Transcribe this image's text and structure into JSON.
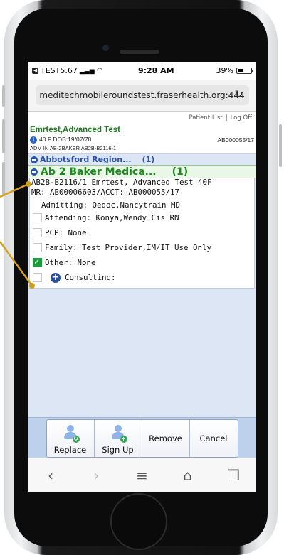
{
  "status_bar": {
    "carrier": "TEST5.67",
    "time": "9:28 AM",
    "battery_text": "39%",
    "battery_level": 0.39
  },
  "browser": {
    "url": "meditechmobileroundstest.fraserhealth.org:444"
  },
  "top_links": {
    "patient_list": "Patient List",
    "separator": "|",
    "log_off": "Log Off"
  },
  "patient": {
    "name": "Emrtest,Advanced Test",
    "demographics": "40 F DOB:19/07/78",
    "account": "AB000055/17",
    "admission": "ADM IN AB-2BAKER AB2B-B2116-1"
  },
  "region": {
    "label": "Abbotsford Region...",
    "count": "(1)"
  },
  "unit": {
    "label": "Ab 2 Baker Medica...",
    "count": "(1)"
  },
  "card": {
    "line1": "AB2B-B2116/1 Emrtest, Advanced Test 40F",
    "line2": "MR: AB00006603/ACCT: AB000055/17",
    "admitting": "Admitting: Oedoc,Nancytrain MD",
    "providers": [
      {
        "label": "Attending: Konya,Wendy Cis RN",
        "checked": false
      },
      {
        "label": "PCP: None",
        "checked": false
      },
      {
        "label": "Family: Test Provider,IM/IT Use Only",
        "checked": false
      },
      {
        "label": "Other: None",
        "checked": true
      }
    ],
    "consulting": "Consulting:"
  },
  "actions": {
    "replace": "Replace",
    "sign_up": "Sign Up",
    "remove": "Remove",
    "cancel": "Cancel"
  },
  "colors": {
    "patient_name": "#1f7a1f",
    "region": "#2a52a8",
    "unit": "#1f8a1f",
    "annotation": "#d4a01e",
    "checkbox_checked": "#1e9b3c"
  },
  "icons": [
    "back-icon",
    "signal-icon",
    "wifi-icon",
    "battery-icon",
    "reload-icon",
    "info-icon",
    "minus-circle-icon",
    "plus-circle-icon",
    "replace-user-icon",
    "signup-user-icon",
    "back-arrow-icon",
    "forward-arrow-icon",
    "menu-icon",
    "home-icon",
    "tabs-icon"
  ]
}
